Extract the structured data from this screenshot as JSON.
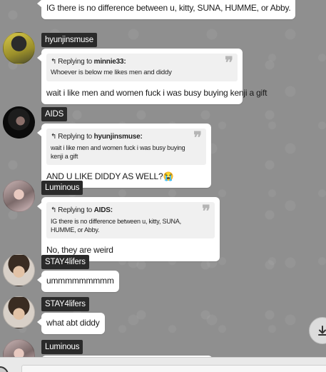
{
  "messages": [
    {
      "text": "IG there is no difference between u, kitty, SUNA, HUMME, or Abby."
    },
    {
      "username": "hyunjinsmuse",
      "reply_label": "Replying to",
      "reply_to": "minnie33:",
      "quoted": "Whoever is below me likes men and diddy",
      "text": "wait i like men and women fuck i was busy buying kenji a gift"
    },
    {
      "username": "AIDS",
      "reply_label": "Replying to",
      "reply_to": "hyunjinsmuse:",
      "quoted": "wait i like men and women fuck i was busy buying kenji a gift",
      "text": "AND U LIKE DIDDY AS WELL?😭"
    },
    {
      "username": "Luminous",
      "reply_label": "Replying to",
      "reply_to": "AIDS:",
      "quoted": "IG there is no difference between u, kitty, SUNA, HUMME, or Abby.",
      "text": "No, they are weird"
    },
    {
      "username": "STAY4lifers",
      "text": "ummmmmmmmm"
    },
    {
      "username": "STAY4lifers",
      "text": "what abt diddy"
    },
    {
      "username": "Luminous"
    }
  ],
  "icons": {
    "reply": "reply-arrow-icon",
    "quote": "quote-mark-icon",
    "scroll_down": "arrow-down-to-line-icon"
  }
}
